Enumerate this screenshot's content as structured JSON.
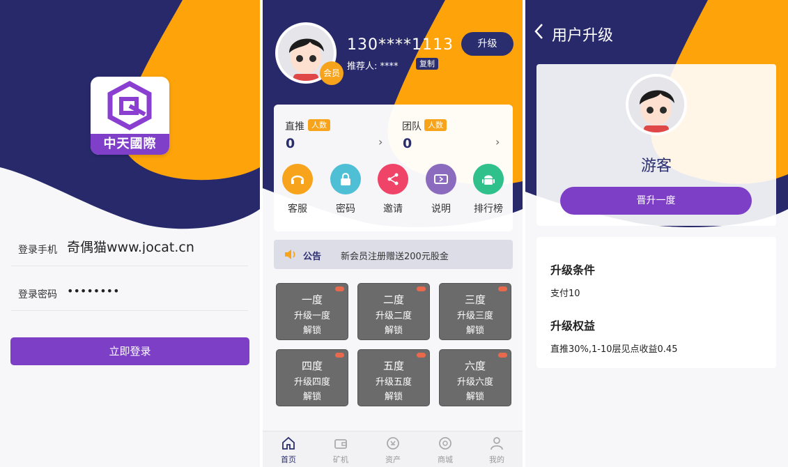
{
  "login": {
    "logo_text": "中天國際",
    "phone_label": "登录手机",
    "phone_value": "奇偶猫www.jocat.cn",
    "password_label": "登录密码",
    "password_value": "••••••••",
    "login_button": "立即登录"
  },
  "home": {
    "member_badge": "会员",
    "phone": "130****1113",
    "referrer_label": "推荐人:",
    "referrer_value": "****",
    "copy_button": "复制",
    "upgrade_button": "升级",
    "stats": [
      {
        "label": "直推",
        "tag": "人数",
        "value": "0"
      },
      {
        "label": "团队",
        "tag": "人数",
        "value": "0"
      }
    ],
    "shortcuts": [
      {
        "label": "客服",
        "color": "#f7a41c",
        "icon": "headset-icon"
      },
      {
        "label": "密码",
        "color": "#4fbfd6",
        "icon": "lock-icon"
      },
      {
        "label": "邀请",
        "color": "#ef4468",
        "icon": "share-icon"
      },
      {
        "label": "说明",
        "color": "#8a6bbd",
        "icon": "ticket-icon"
      },
      {
        "label": "排行榜",
        "color": "#2fc08c",
        "icon": "android-icon"
      }
    ],
    "notice_title": "公告",
    "notice_text": "新会员注册赠送200元股金",
    "levels": [
      {
        "title": "一度",
        "sub": "升级一度",
        "action": "解锁"
      },
      {
        "title": "二度",
        "sub": "升级二度",
        "action": "解锁"
      },
      {
        "title": "三度",
        "sub": "升级三度",
        "action": "解锁"
      },
      {
        "title": "四度",
        "sub": "升级四度",
        "action": "解锁"
      },
      {
        "title": "五度",
        "sub": "升级五度",
        "action": "解锁"
      },
      {
        "title": "六度",
        "sub": "升级六度",
        "action": "解锁"
      }
    ],
    "tabs": [
      {
        "label": "首页",
        "icon": "home-icon"
      },
      {
        "label": "矿机",
        "icon": "wallet-icon"
      },
      {
        "label": "资产",
        "icon": "assets-icon"
      },
      {
        "label": "商城",
        "icon": "store-icon"
      },
      {
        "label": "我的",
        "icon": "user-icon"
      }
    ]
  },
  "upgrade": {
    "title": "用户升级",
    "role": "游客",
    "promote_button": "晋升一度",
    "conditions_title": "升级条件",
    "conditions_text": "支付10",
    "benefits_title": "升级权益",
    "benefits_text": "直推30%,1-10层见点收益0.45"
  },
  "colors": {
    "navy": "#2a2d6e",
    "orange": "#fea40a",
    "purple": "#7e3fc7"
  }
}
